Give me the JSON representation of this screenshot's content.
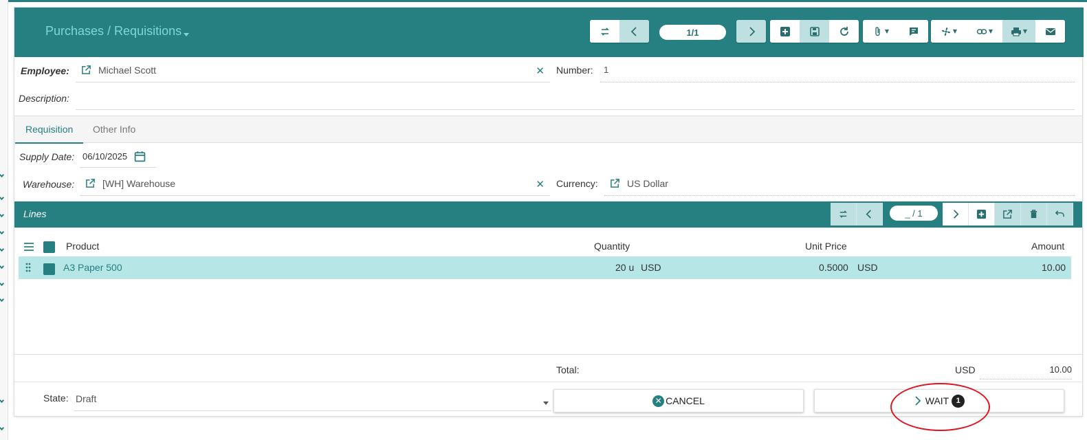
{
  "header": {
    "breadcrumb": "Purchases / Requisitions",
    "pager": "1/1"
  },
  "form": {
    "employee_label": "Employee:",
    "employee_value": "Michael Scott",
    "number_label": "Number:",
    "number_value": "1",
    "description_label": "Description:",
    "description_value": ""
  },
  "tabs": [
    {
      "label": "Requisition",
      "active": true
    },
    {
      "label": "Other Info",
      "active": false
    }
  ],
  "requisition": {
    "supply_date_label": "Supply Date:",
    "supply_date_value": "06/10/2025",
    "warehouse_label": "Warehouse:",
    "warehouse_value": "[WH] Warehouse",
    "currency_label": "Currency:",
    "currency_value": "US Dollar"
  },
  "lines": {
    "title": "Lines",
    "pager": "_ / 1",
    "columns": {
      "product": "Product",
      "quantity": "Quantity",
      "unit_price": "Unit Price",
      "amount": "Amount"
    },
    "rows": [
      {
        "product": "A3 Paper 500",
        "quantity": "20 u",
        "qty_currency": "USD",
        "unit_price": "0.5000",
        "price_currency": "USD",
        "amount": "10.00"
      }
    ]
  },
  "total": {
    "label": "Total:",
    "currency": "USD",
    "value": "10.00"
  },
  "state": {
    "label": "State:",
    "value": "Draft"
  },
  "actions": {
    "cancel_label": "CANCEL",
    "wait_label": "WAIT",
    "wait_badge": "1"
  },
  "colors": {
    "brand": "#267f81",
    "breadcrumb": "#7fd6d6",
    "selected_row": "#b7e6e6",
    "highlight": "#e0141c"
  }
}
